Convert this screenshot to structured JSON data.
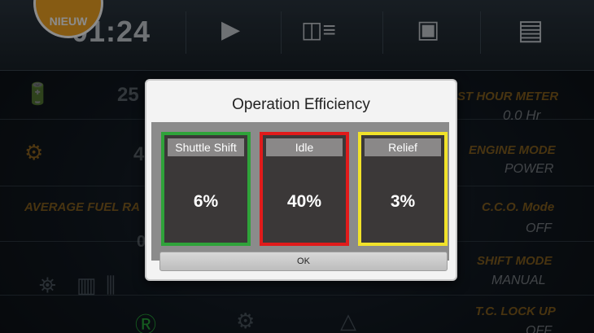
{
  "badge": {
    "label": "NIEUW"
  },
  "topbar": {
    "clock": "01:24",
    "icons": [
      "horn-icon",
      "wiper-icon",
      "mirror-icon",
      "document-icon"
    ]
  },
  "left_panel": {
    "battery_value": "25",
    "temp_value": "4",
    "avg_fuel_label": "AVERAGE FUEL RA",
    "avg_fuel_value": "0"
  },
  "right_panel": {
    "hour_meter_label": "ST HOUR METER",
    "hour_meter_value": "0.0",
    "hour_meter_unit": "Hr",
    "engine_mode_label": "ENGINE MODE",
    "engine_mode_value": "POWER",
    "cco_label": "C.C.O. Mode",
    "cco_value": "OFF",
    "shift_mode_label": "SHIFT MODE",
    "shift_mode_value": "MANUAL",
    "tc_lockup_label": "T.C. LOCK UP",
    "tc_lockup_value": "OFF"
  },
  "dialog": {
    "title": "Operation Efficiency",
    "cards": [
      {
        "label": "Shuttle Shift",
        "value": "6%",
        "border_color": "#2fa33a"
      },
      {
        "label": "Idle",
        "value": "40%",
        "border_color": "#e01b1b"
      },
      {
        "label": "Relief",
        "value": "3%",
        "border_color": "#f1e22a"
      }
    ],
    "ok_label": "OK"
  },
  "colors": {
    "accent": "#f5a623",
    "label_orange": "#e29a1e"
  }
}
